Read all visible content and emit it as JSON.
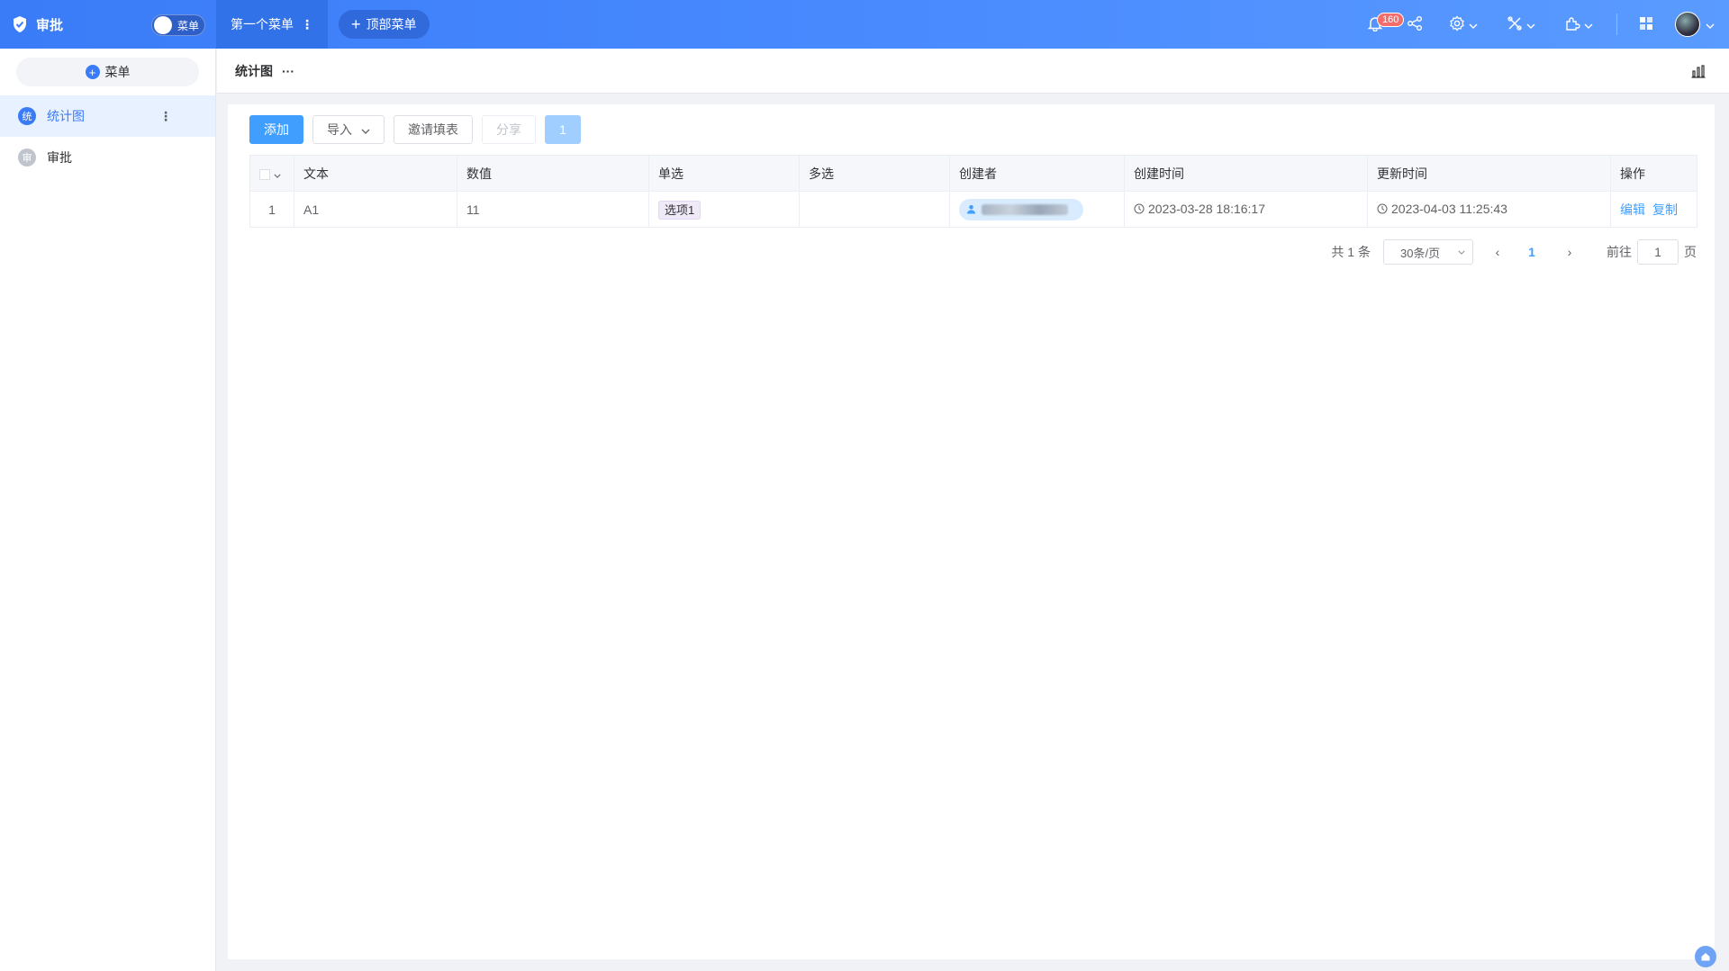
{
  "app": {
    "title": "审批",
    "menu_toggle_label": "菜单"
  },
  "header": {
    "active_tab": "第一个菜单",
    "add_top_menu": "顶部菜单",
    "notification_count": "160"
  },
  "sidebar": {
    "add_menu": "菜单",
    "items": [
      {
        "icon_char": "统",
        "label": "统计图"
      },
      {
        "icon_char": "审",
        "label": "审批"
      }
    ]
  },
  "page": {
    "title": "统计图",
    "title_more": "···"
  },
  "toolbar": {
    "add": "添加",
    "import": "导入",
    "invite": "邀请填表",
    "share": "分享",
    "count": "1"
  },
  "table": {
    "columns": [
      "文本",
      "数值",
      "单选",
      "多选",
      "创建者",
      "创建时间",
      "更新时间",
      "操作"
    ],
    "rows": [
      {
        "index": "1",
        "text": "A1",
        "number": "11",
        "single": "选项1",
        "multi": "",
        "created": "2023-03-28 18:16:17",
        "updated": "2023-04-03 11:25:43",
        "ops": [
          "编辑",
          "复制"
        ]
      }
    ]
  },
  "pager": {
    "total": "共 1 条",
    "page_size": "30条/页",
    "current": "1",
    "goto_label": "前往",
    "goto_value": "1",
    "page_suffix": "页"
  },
  "colors": {
    "primary": "#409eff",
    "header": "#3a7cf7",
    "badge": "#f56c6c"
  },
  "icons": [
    "shield-icon",
    "bell-icon",
    "share-icon",
    "gear-icon",
    "tools-icon",
    "plugin-icon",
    "grid-icon",
    "bar-chart-icon",
    "clock-icon",
    "user-icon"
  ]
}
